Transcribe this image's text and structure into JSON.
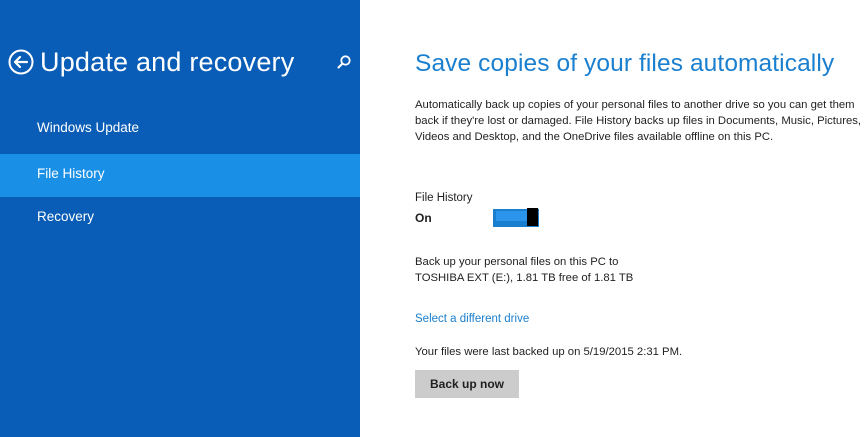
{
  "colors": {
    "sidebar_bg": "#0a5db6",
    "selected_item_bg": "#1a8fe6",
    "accent": "#1a7fcf",
    "button_bg": "#cccccc"
  },
  "sidebar": {
    "back_icon": "back-arrow-circle-icon",
    "title": "Update and recovery",
    "search_icon": "search-icon",
    "items": [
      {
        "label": "Windows Update",
        "selected": false
      },
      {
        "label": "File History",
        "selected": true
      },
      {
        "label": "Recovery",
        "selected": false
      }
    ]
  },
  "main": {
    "title": "Save copies of your files automatically",
    "description": "Automatically back up copies of your personal files to another drive so you can get them back if they're lost or damaged. File History backs up files in Documents, Music, Pictures, Videos and Desktop, and the OneDrive files available offline on this PC.",
    "file_history": {
      "label": "File History",
      "state": "On",
      "enabled": true
    },
    "backup_line1": "Back up your personal files on this PC to",
    "backup_line2": "TOSHIBA EXT (E:), 1.81 TB free of 1.81 TB",
    "select_drive_link": "Select a different drive",
    "last_backup": "Your files were last backed up on 5/19/2015 2:31 PM.",
    "backup_button": "Back up now"
  }
}
